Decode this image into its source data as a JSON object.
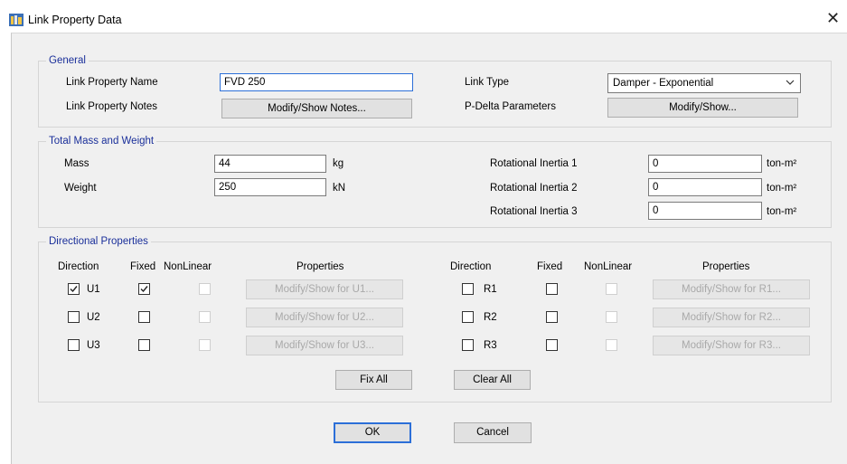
{
  "window": {
    "title": "Link Property Data",
    "close_glyph": "✕"
  },
  "general": {
    "legend": "General",
    "name_label": "Link Property Name",
    "name_value": "FVD 250",
    "notes_label": "Link Property Notes",
    "notes_button": "Modify/Show Notes...",
    "type_label": "Link Type",
    "type_value": "Damper - Exponential",
    "pdelta_label": "P-Delta Parameters",
    "pdelta_button": "Modify/Show..."
  },
  "mass": {
    "legend": "Total Mass and Weight",
    "mass_label": "Mass",
    "mass_value": "44",
    "mass_unit": "kg",
    "weight_label": "Weight",
    "weight_value": "250",
    "weight_unit": "kN",
    "ri1_label": "Rotational Inertia 1",
    "ri1_value": "0",
    "ri2_label": "Rotational Inertia 2",
    "ri2_value": "0",
    "ri3_label": "Rotational Inertia 3",
    "ri3_value": "0",
    "ri_unit": "ton-m²"
  },
  "directional": {
    "legend": "Directional Properties",
    "headers": {
      "direction": "Direction",
      "fixed": "Fixed",
      "nonlinear": "NonLinear",
      "properties": "Properties"
    },
    "left": [
      {
        "dir": "U1",
        "checked": true,
        "fixed": true,
        "button": "Modify/Show for U1..."
      },
      {
        "dir": "U2",
        "checked": false,
        "fixed": false,
        "button": "Modify/Show for U2..."
      },
      {
        "dir": "U3",
        "checked": false,
        "fixed": false,
        "button": "Modify/Show for U3..."
      }
    ],
    "right": [
      {
        "dir": "R1",
        "checked": false,
        "fixed": false,
        "button": "Modify/Show for R1..."
      },
      {
        "dir": "R2",
        "checked": false,
        "fixed": false,
        "button": "Modify/Show for R2..."
      },
      {
        "dir": "R3",
        "checked": false,
        "fixed": false,
        "button": "Modify/Show for R3..."
      }
    ],
    "fix_all": "Fix All",
    "clear_all": "Clear All"
  },
  "footer": {
    "ok": "OK",
    "cancel": "Cancel"
  }
}
